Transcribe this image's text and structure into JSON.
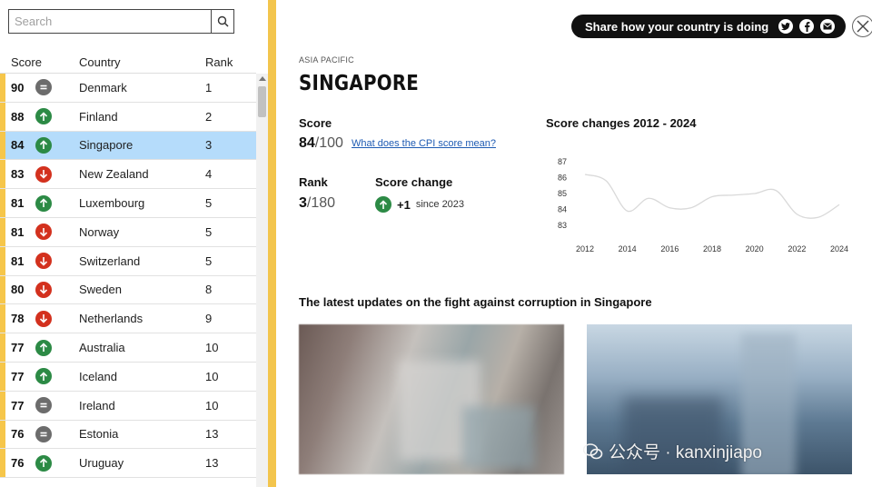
{
  "search": {
    "placeholder": "Search"
  },
  "table": {
    "headers": {
      "score": "Score",
      "country": "Country",
      "rank": "Rank"
    },
    "rows": [
      {
        "score": "90",
        "change": "same",
        "country": "Denmark",
        "rank": "1"
      },
      {
        "score": "88",
        "change": "up",
        "country": "Finland",
        "rank": "2"
      },
      {
        "score": "84",
        "change": "up",
        "country": "Singapore",
        "rank": "3",
        "selected": true
      },
      {
        "score": "83",
        "change": "down",
        "country": "New Zealand",
        "rank": "4"
      },
      {
        "score": "81",
        "change": "up",
        "country": "Luxembourg",
        "rank": "5"
      },
      {
        "score": "81",
        "change": "down",
        "country": "Norway",
        "rank": "5"
      },
      {
        "score": "81",
        "change": "down",
        "country": "Switzerland",
        "rank": "5"
      },
      {
        "score": "80",
        "change": "down",
        "country": "Sweden",
        "rank": "8"
      },
      {
        "score": "78",
        "change": "down",
        "country": "Netherlands",
        "rank": "9"
      },
      {
        "score": "77",
        "change": "up",
        "country": "Australia",
        "rank": "10"
      },
      {
        "score": "77",
        "change": "up",
        "country": "Iceland",
        "rank": "10"
      },
      {
        "score": "77",
        "change": "same",
        "country": "Ireland",
        "rank": "10"
      },
      {
        "score": "76",
        "change": "same",
        "country": "Estonia",
        "rank": "13"
      },
      {
        "score": "76",
        "change": "up",
        "country": "Uruguay",
        "rank": "13"
      }
    ]
  },
  "share": {
    "label": "Share how your country is doing",
    "icons": [
      "twitter-icon",
      "facebook-icon",
      "email-icon"
    ]
  },
  "detail": {
    "region": "ASIA PACIFIC",
    "country": "SINGAPORE",
    "score_label": "Score",
    "score_value": "84",
    "score_max": "/100",
    "score_link": "What does the CPI score mean?",
    "rank_label": "Rank",
    "rank_value": "3",
    "rank_total": "/180",
    "change_label": "Score change",
    "change_value": "+1",
    "change_since": "since 2023",
    "updates_title": "The latest updates on the fight against corruption in Singapore"
  },
  "chart_data": {
    "type": "line",
    "title": "Score changes 2012 - 2024",
    "x": [
      2012,
      2013,
      2014,
      2015,
      2016,
      2017,
      2018,
      2019,
      2020,
      2021,
      2022,
      2023,
      2024
    ],
    "values": [
      86.2,
      85.8,
      83.9,
      84.7,
      84.1,
      84.1,
      84.8,
      84.9,
      85.0,
      85.2,
      83.7,
      83.5,
      84.3
    ],
    "xticks": [
      "2012",
      "2014",
      "2016",
      "2018",
      "2020",
      "2022",
      "2024"
    ],
    "yticks": [
      "87",
      "86",
      "85",
      "84",
      "83"
    ],
    "ylim": [
      83,
      87
    ],
    "line_color": "#d9d9d9"
  },
  "watermark": "公众号 · kanxinjiapo",
  "colors": {
    "accent": "#f3c54d",
    "up": "#2c8a45",
    "down": "#d3311e",
    "same": "#6c6c6c",
    "selected": "#b5dcfb"
  }
}
